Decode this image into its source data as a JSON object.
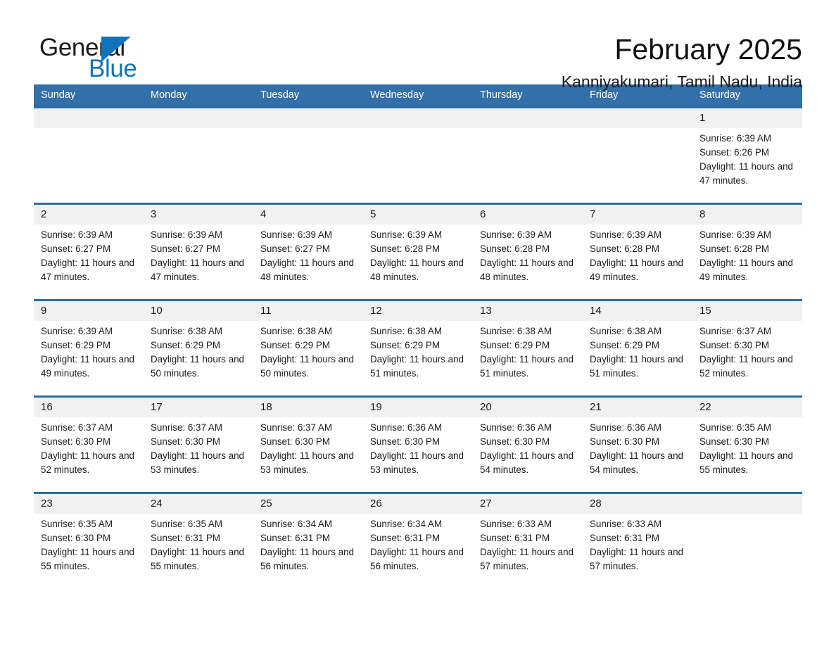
{
  "brand": {
    "name_part1": "General",
    "name_part2": "Blue",
    "accent_color": "#1273bd",
    "triangle_icon": "triangle-right-icon"
  },
  "header": {
    "title": "February 2025",
    "subtitle": "Kanniyakumari, Tamil Nadu, India"
  },
  "calendar": {
    "header_bg": "#336fa8",
    "row_divider_color": "#2e6da4",
    "daynum_bg": "#f1f1f1",
    "weekdays": [
      "Sunday",
      "Monday",
      "Tuesday",
      "Wednesday",
      "Thursday",
      "Friday",
      "Saturday"
    ],
    "weeks": [
      [
        {
          "day": "",
          "sunrise": "",
          "sunset": "",
          "daylight": "",
          "empty": true
        },
        {
          "day": "",
          "sunrise": "",
          "sunset": "",
          "daylight": "",
          "empty": true
        },
        {
          "day": "",
          "sunrise": "",
          "sunset": "",
          "daylight": "",
          "empty": true
        },
        {
          "day": "",
          "sunrise": "",
          "sunset": "",
          "daylight": "",
          "empty": true
        },
        {
          "day": "",
          "sunrise": "",
          "sunset": "",
          "daylight": "",
          "empty": true
        },
        {
          "day": "",
          "sunrise": "",
          "sunset": "",
          "daylight": "",
          "empty": true
        },
        {
          "day": "1",
          "sunrise": "Sunrise: 6:39 AM",
          "sunset": "Sunset: 6:26 PM",
          "daylight": "Daylight: 11 hours and 47 minutes.",
          "empty": false
        }
      ],
      [
        {
          "day": "2",
          "sunrise": "Sunrise: 6:39 AM",
          "sunset": "Sunset: 6:27 PM",
          "daylight": "Daylight: 11 hours and 47 minutes.",
          "empty": false
        },
        {
          "day": "3",
          "sunrise": "Sunrise: 6:39 AM",
          "sunset": "Sunset: 6:27 PM",
          "daylight": "Daylight: 11 hours and 47 minutes.",
          "empty": false
        },
        {
          "day": "4",
          "sunrise": "Sunrise: 6:39 AM",
          "sunset": "Sunset: 6:27 PM",
          "daylight": "Daylight: 11 hours and 48 minutes.",
          "empty": false
        },
        {
          "day": "5",
          "sunrise": "Sunrise: 6:39 AM",
          "sunset": "Sunset: 6:28 PM",
          "daylight": "Daylight: 11 hours and 48 minutes.",
          "empty": false
        },
        {
          "day": "6",
          "sunrise": "Sunrise: 6:39 AM",
          "sunset": "Sunset: 6:28 PM",
          "daylight": "Daylight: 11 hours and 48 minutes.",
          "empty": false
        },
        {
          "day": "7",
          "sunrise": "Sunrise: 6:39 AM",
          "sunset": "Sunset: 6:28 PM",
          "daylight": "Daylight: 11 hours and 49 minutes.",
          "empty": false
        },
        {
          "day": "8",
          "sunrise": "Sunrise: 6:39 AM",
          "sunset": "Sunset: 6:28 PM",
          "daylight": "Daylight: 11 hours and 49 minutes.",
          "empty": false
        }
      ],
      [
        {
          "day": "9",
          "sunrise": "Sunrise: 6:39 AM",
          "sunset": "Sunset: 6:29 PM",
          "daylight": "Daylight: 11 hours and 49 minutes.",
          "empty": false
        },
        {
          "day": "10",
          "sunrise": "Sunrise: 6:38 AM",
          "sunset": "Sunset: 6:29 PM",
          "daylight": "Daylight: 11 hours and 50 minutes.",
          "empty": false
        },
        {
          "day": "11",
          "sunrise": "Sunrise: 6:38 AM",
          "sunset": "Sunset: 6:29 PM",
          "daylight": "Daylight: 11 hours and 50 minutes.",
          "empty": false
        },
        {
          "day": "12",
          "sunrise": "Sunrise: 6:38 AM",
          "sunset": "Sunset: 6:29 PM",
          "daylight": "Daylight: 11 hours and 51 minutes.",
          "empty": false
        },
        {
          "day": "13",
          "sunrise": "Sunrise: 6:38 AM",
          "sunset": "Sunset: 6:29 PM",
          "daylight": "Daylight: 11 hours and 51 minutes.",
          "empty": false
        },
        {
          "day": "14",
          "sunrise": "Sunrise: 6:38 AM",
          "sunset": "Sunset: 6:29 PM",
          "daylight": "Daylight: 11 hours and 51 minutes.",
          "empty": false
        },
        {
          "day": "15",
          "sunrise": "Sunrise: 6:37 AM",
          "sunset": "Sunset: 6:30 PM",
          "daylight": "Daylight: 11 hours and 52 minutes.",
          "empty": false
        }
      ],
      [
        {
          "day": "16",
          "sunrise": "Sunrise: 6:37 AM",
          "sunset": "Sunset: 6:30 PM",
          "daylight": "Daylight: 11 hours and 52 minutes.",
          "empty": false
        },
        {
          "day": "17",
          "sunrise": "Sunrise: 6:37 AM",
          "sunset": "Sunset: 6:30 PM",
          "daylight": "Daylight: 11 hours and 53 minutes.",
          "empty": false
        },
        {
          "day": "18",
          "sunrise": "Sunrise: 6:37 AM",
          "sunset": "Sunset: 6:30 PM",
          "daylight": "Daylight: 11 hours and 53 minutes.",
          "empty": false
        },
        {
          "day": "19",
          "sunrise": "Sunrise: 6:36 AM",
          "sunset": "Sunset: 6:30 PM",
          "daylight": "Daylight: 11 hours and 53 minutes.",
          "empty": false
        },
        {
          "day": "20",
          "sunrise": "Sunrise: 6:36 AM",
          "sunset": "Sunset: 6:30 PM",
          "daylight": "Daylight: 11 hours and 54 minutes.",
          "empty": false
        },
        {
          "day": "21",
          "sunrise": "Sunrise: 6:36 AM",
          "sunset": "Sunset: 6:30 PM",
          "daylight": "Daylight: 11 hours and 54 minutes.",
          "empty": false
        },
        {
          "day": "22",
          "sunrise": "Sunrise: 6:35 AM",
          "sunset": "Sunset: 6:30 PM",
          "daylight": "Daylight: 11 hours and 55 minutes.",
          "empty": false
        }
      ],
      [
        {
          "day": "23",
          "sunrise": "Sunrise: 6:35 AM",
          "sunset": "Sunset: 6:30 PM",
          "daylight": "Daylight: 11 hours and 55 minutes.",
          "empty": false
        },
        {
          "day": "24",
          "sunrise": "Sunrise: 6:35 AM",
          "sunset": "Sunset: 6:31 PM",
          "daylight": "Daylight: 11 hours and 55 minutes.",
          "empty": false
        },
        {
          "day": "25",
          "sunrise": "Sunrise: 6:34 AM",
          "sunset": "Sunset: 6:31 PM",
          "daylight": "Daylight: 11 hours and 56 minutes.",
          "empty": false
        },
        {
          "day": "26",
          "sunrise": "Sunrise: 6:34 AM",
          "sunset": "Sunset: 6:31 PM",
          "daylight": "Daylight: 11 hours and 56 minutes.",
          "empty": false
        },
        {
          "day": "27",
          "sunrise": "Sunrise: 6:33 AM",
          "sunset": "Sunset: 6:31 PM",
          "daylight": "Daylight: 11 hours and 57 minutes.",
          "empty": false
        },
        {
          "day": "28",
          "sunrise": "Sunrise: 6:33 AM",
          "sunset": "Sunset: 6:31 PM",
          "daylight": "Daylight: 11 hours and 57 minutes.",
          "empty": false
        },
        {
          "day": "",
          "sunrise": "",
          "sunset": "",
          "daylight": "",
          "empty": true
        }
      ]
    ]
  }
}
